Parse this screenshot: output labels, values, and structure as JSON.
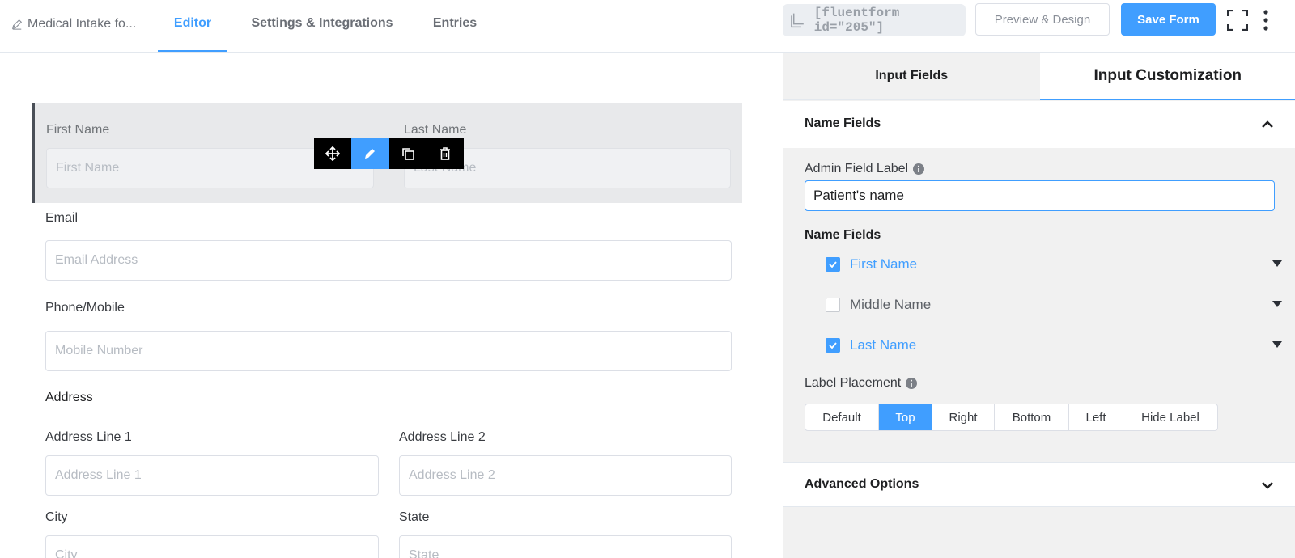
{
  "header": {
    "form_title": "Medical Intake fo...",
    "tabs": [
      {
        "label": "Editor",
        "active": true
      },
      {
        "label": "Settings & Integrations",
        "active": false
      },
      {
        "label": "Entries",
        "active": false
      }
    ],
    "shortcode": "[fluentform id=\"205\"]",
    "preview_label": "Preview & Design",
    "save_label": "Save Form"
  },
  "form": {
    "first_name_label": "First Name",
    "first_name_placeholder": "First Name",
    "last_name_label": "Last Name",
    "last_name_placeholder": "Last Name",
    "email_label": "Email",
    "email_placeholder": "Email Address",
    "phone_label": "Phone/Mobile",
    "phone_placeholder": "Mobile Number",
    "address_title": "Address",
    "address1_label": "Address Line 1",
    "address1_placeholder": "Address Line 1",
    "address2_label": "Address Line 2",
    "address2_placeholder": "Address Line 2",
    "city_label": "City",
    "city_placeholder": "City",
    "state_label": "State",
    "state_placeholder": "State"
  },
  "panel": {
    "tabs": [
      {
        "label": "Input Fields",
        "active": false
      },
      {
        "label": "Input Customization",
        "active": true
      }
    ],
    "section_title": "Name Fields",
    "admin_label": "Admin Field Label",
    "admin_value": "Patient's name",
    "name_fields_title": "Name Fields",
    "name_fields": [
      {
        "label": "First Name",
        "checked": true
      },
      {
        "label": "Middle Name",
        "checked": false
      },
      {
        "label": "Last Name",
        "checked": true
      }
    ],
    "label_placement_title": "Label Placement",
    "placements": [
      {
        "label": "Default",
        "active": false
      },
      {
        "label": "Top",
        "active": true
      },
      {
        "label": "Right",
        "active": false
      },
      {
        "label": "Bottom",
        "active": false
      },
      {
        "label": "Left",
        "active": false
      },
      {
        "label": "Hide Label",
        "active": false
      }
    ],
    "advanced_title": "Advanced Options"
  },
  "colors": {
    "accent": "#409eff",
    "panel_bg": "#f1f1f1",
    "selected_row_bg": "#e8e9eb"
  }
}
